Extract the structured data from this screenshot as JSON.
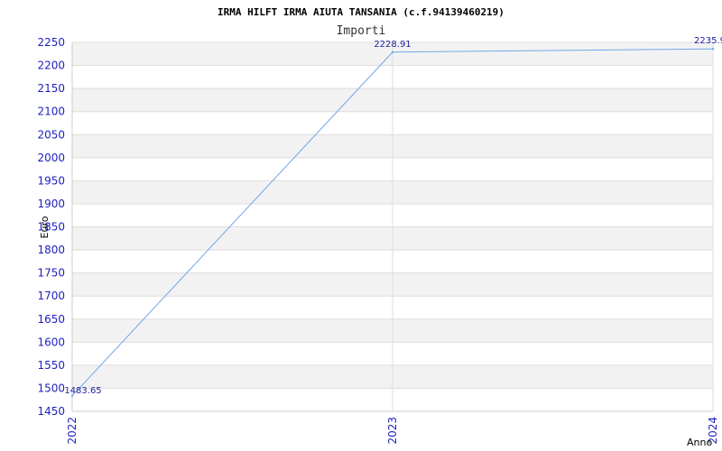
{
  "chart_data": {
    "type": "line",
    "title": "IRMA HILFT IRMA AIUTA TANSANIA (c.f.94139460219)",
    "subtitle": "Importi",
    "xlabel": "Anno",
    "ylabel": "Euro",
    "categories": [
      "2022",
      "2023",
      "2024"
    ],
    "series": [
      {
        "values": [
          1483.65,
          2228.91,
          2235.9
        ]
      }
    ],
    "data_labels": [
      "1483.65",
      "2228.91",
      "2235.9"
    ],
    "ylim": [
      1450,
      2250
    ],
    "yticks": [
      1450,
      1500,
      1550,
      1600,
      1650,
      1700,
      1750,
      1800,
      1850,
      1900,
      1950,
      2000,
      2050,
      2100,
      2150,
      2200,
      2250
    ],
    "grid": true,
    "line_color": "#6fa8e8",
    "band_color": "#f2f2f2",
    "tick_color": "#1f1fbf"
  }
}
